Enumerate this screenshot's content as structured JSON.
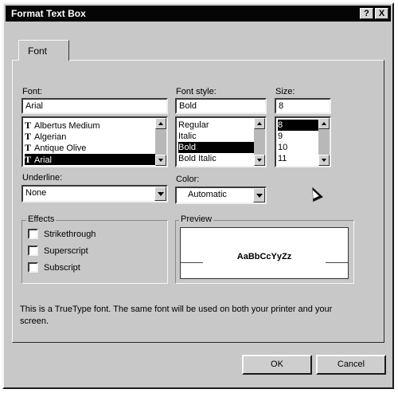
{
  "window": {
    "title": "Format Text Box",
    "help_glyph": "?",
    "close_glyph": "X"
  },
  "tabs": [
    {
      "label": "Font",
      "selected": true
    }
  ],
  "font": {
    "label": "Font:",
    "value": "Arial",
    "items": [
      {
        "name": "Albertus Medium",
        "icon": "truetype-icon",
        "selected": false
      },
      {
        "name": "Algerian",
        "icon": "truetype-icon",
        "selected": false
      },
      {
        "name": "Antique Olive",
        "icon": "truetype-icon",
        "selected": false
      },
      {
        "name": "Arial",
        "icon": "truetype-icon",
        "selected": true
      }
    ]
  },
  "font_style": {
    "label": "Font style:",
    "value": "Bold",
    "items": [
      {
        "name": "Regular",
        "selected": false
      },
      {
        "name": "Italic",
        "selected": false
      },
      {
        "name": "Bold",
        "selected": true
      },
      {
        "name": "Bold Italic",
        "selected": false
      }
    ]
  },
  "size": {
    "label": "Size:",
    "value": "8",
    "items": [
      {
        "name": "8",
        "selected": true
      },
      {
        "name": "9",
        "selected": false
      },
      {
        "name": "10",
        "selected": false
      },
      {
        "name": "11",
        "selected": false
      }
    ]
  },
  "underline": {
    "label": "Underline:",
    "value": "None"
  },
  "color": {
    "label": "Color:",
    "value": "Automatic"
  },
  "effects": {
    "label": "Effects",
    "items": [
      {
        "label": "Strikethrough",
        "checked": false
      },
      {
        "label": "Superscript",
        "checked": false
      },
      {
        "label": "Subscript",
        "checked": false
      }
    ]
  },
  "preview": {
    "label": "Preview",
    "sample": "AaBbCcYyZz"
  },
  "info": "This is a TrueType font.  The same font will be used on both your printer and your screen.",
  "buttons": {
    "ok": "OK",
    "cancel": "Cancel"
  },
  "colors": {
    "titlebar": "#050505",
    "face": "#c8c8c8",
    "selection": "#000000"
  }
}
